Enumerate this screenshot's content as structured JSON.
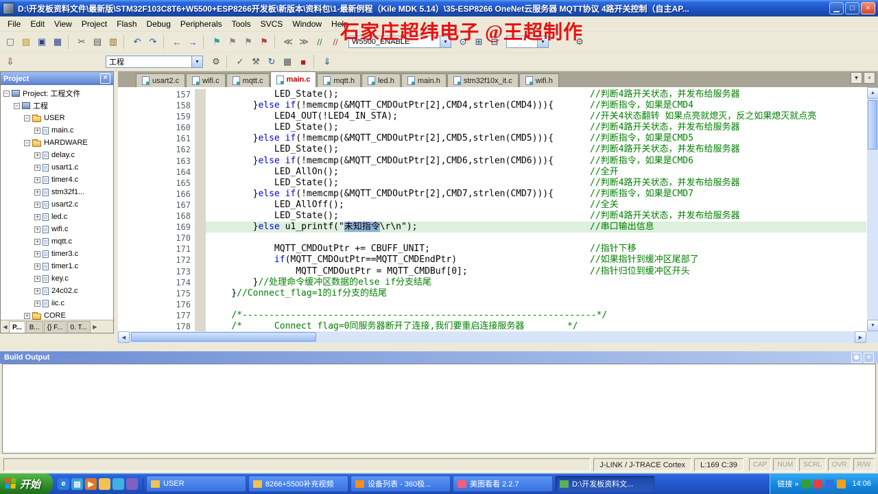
{
  "window": {
    "title": "D:\\开发板资料文件\\最新版\\STM32F103C8T6+W5500+ESP8266开发板\\新版本\\资料包\\1-最新例程（Kile MDK 5.14）\\35-ESP8266 OneNet云服务器 MQTT协议 4路开关控制（自主AP...",
    "overlay_text": "石家庄超纬电子 @王超制作",
    "buttons": {
      "minimize": "▁",
      "maximize": "□",
      "close": "×"
    }
  },
  "icons": {
    "chevron_down": "▼",
    "close": "×",
    "pin": "◉",
    "scroll_left": "◀",
    "scroll_right": "▶",
    "links_chevron": "»",
    "combo_arrow": "▼"
  },
  "menu": {
    "items": [
      "File",
      "Edit",
      "View",
      "Project",
      "Flash",
      "Debug",
      "Peripherals",
      "Tools",
      "SVCS",
      "Window",
      "Help"
    ]
  },
  "toolbar": {
    "find_value": "W5500_ENABLE",
    "icons_left": [
      {
        "name": "new-file-icon",
        "glyph": "▢",
        "color": "#4a6a9a"
      },
      {
        "name": "open-folder-icon",
        "glyph": "▨",
        "color": "#c09020"
      },
      {
        "name": "save-icon",
        "glyph": "▣",
        "color": "#27408b"
      },
      {
        "name": "save-all-icon",
        "glyph": "▦",
        "color": "#27408b"
      },
      {
        "sep": true
      },
      {
        "name": "cut-icon",
        "glyph": "✂",
        "color": "#555555"
      },
      {
        "name": "copy-icon",
        "glyph": "▤",
        "color": "#555555"
      },
      {
        "name": "paste-icon",
        "glyph": "▥",
        "color": "#8a6c1e"
      },
      {
        "sep": true
      },
      {
        "name": "undo-icon",
        "glyph": "↶",
        "color": "#2458b0"
      },
      {
        "name": "redo-icon",
        "glyph": "↷",
        "color": "#2458b0"
      },
      {
        "sep": true
      },
      {
        "name": "back-icon",
        "glyph": "←",
        "color": "#2458b0"
      },
      {
        "name": "forward-icon",
        "glyph": "→",
        "color": "#2458b0"
      },
      {
        "sep": true
      },
      {
        "name": "bookmark-icon",
        "glyph": "⚑",
        "color": "#2aa0a0"
      },
      {
        "name": "prev-bookmark-icon",
        "glyph": "⚑",
        "color": "#888888"
      },
      {
        "name": "next-bookmark-icon",
        "glyph": "⚑",
        "color": "#888888"
      },
      {
        "name": "clear-bookmarks-icon",
        "glyph": "⚑",
        "color": "#b04040"
      },
      {
        "sep": true
      },
      {
        "name": "unindent-icon",
        "glyph": "≪",
        "color": "#555555"
      },
      {
        "name": "indent-icon",
        "glyph": "≫",
        "color": "#555555"
      },
      {
        "name": "comment-icon",
        "glyph": "//",
        "color": "#2a8a2a"
      },
      {
        "name": "uncomment-icon",
        "glyph": "//",
        "color": "#b04040"
      }
    ],
    "icons_find": [
      {
        "name": "find-icon",
        "glyph": "⊙",
        "color": "#27408b"
      },
      {
        "name": "find-in-files-icon",
        "glyph": "⊞",
        "color": "#27408b"
      },
      {
        "name": "grep-icon",
        "glyph": "⊟",
        "color": "#27408b"
      }
    ],
    "icons_end": [
      {
        "name": "configure-icon",
        "glyph": "⚙",
        "color": "#555555"
      }
    ]
  },
  "toolbar2": {
    "target_value": "工程",
    "icons_left": [
      {
        "name": "flash-download-icon",
        "glyph": "⇩",
        "color": "#7a2020"
      }
    ],
    "icons_right": [
      {
        "name": "options-target-icon",
        "glyph": "⚙",
        "color": "#555555"
      },
      {
        "sep": true
      },
      {
        "name": "translate-icon",
        "glyph": "✓",
        "color": "#2a7a2a"
      },
      {
        "name": "build-icon",
        "glyph": "⚒",
        "color": "#555555"
      },
      {
        "name": "rebuild-icon",
        "glyph": "↻",
        "color": "#2458b0"
      },
      {
        "name": "batch-build-icon",
        "glyph": "▦",
        "color": "#555555"
      },
      {
        "name": "stop-build-icon",
        "glyph": "■",
        "color": "#b02020"
      },
      {
        "sep": true
      },
      {
        "name": "download-icon",
        "glyph": "⇓",
        "color": "#27408b"
      }
    ]
  },
  "project_panel": {
    "title": "Project",
    "tree": [
      {
        "label": "Project: 工程文件",
        "level": 0,
        "box": "minus",
        "icon": "chip"
      },
      {
        "label": "工程",
        "level": 1,
        "box": "minus",
        "icon": "chip"
      },
      {
        "label": "USER",
        "level": 2,
        "box": "minus",
        "icon": "folder"
      },
      {
        "label": "main.c",
        "level": 3,
        "box": "plus",
        "icon": "file"
      },
      {
        "label": "HARDWARE",
        "level": 2,
        "box": "minus",
        "icon": "folder"
      },
      {
        "label": "delay.c",
        "level": 3,
        "box": "plus",
        "icon": "file"
      },
      {
        "label": "usart1.c",
        "level": 3,
        "box": "plus",
        "icon": "file"
      },
      {
        "label": "timer4.c",
        "level": 3,
        "box": "plus",
        "icon": "file"
      },
      {
        "label": "stm32f1...",
        "level": 3,
        "box": "plus",
        "icon": "file"
      },
      {
        "label": "usart2.c",
        "level": 3,
        "box": "plus",
        "icon": "file"
      },
      {
        "label": "led.c",
        "level": 3,
        "box": "plus",
        "icon": "file"
      },
      {
        "label": "wifi.c",
        "level": 3,
        "box": "plus",
        "icon": "file"
      },
      {
        "label": "mqtt.c",
        "level": 3,
        "box": "plus",
        "icon": "file"
      },
      {
        "label": "timer3.c",
        "level": 3,
        "box": "plus",
        "icon": "file"
      },
      {
        "label": "timer1.c",
        "level": 3,
        "box": "plus",
        "icon": "file"
      },
      {
        "label": "key.c",
        "level": 3,
        "box": "plus",
        "icon": "file"
      },
      {
        "label": "24c02.c",
        "level": 3,
        "box": "plus",
        "icon": "file"
      },
      {
        "label": "iic.c",
        "level": 3,
        "box": "plus",
        "icon": "file"
      },
      {
        "label": "CORE",
        "level": 2,
        "box": "plus",
        "icon": "folder"
      }
    ],
    "bottom_tabs": [
      {
        "label": "P...",
        "name": "tab-project",
        "active": true
      },
      {
        "label": "B...",
        "name": "tab-books"
      },
      {
        "label": "{} F...",
        "name": "tab-functions"
      },
      {
        "label": "0. T...",
        "name": "tab-templates"
      }
    ]
  },
  "editor": {
    "tabs": [
      {
        "label": "usart2.c"
      },
      {
        "label": "wifi.c"
      },
      {
        "label": "mqtt.c"
      },
      {
        "label": "main.c",
        "active": true
      },
      {
        "label": "mqtt.h"
      },
      {
        "label": "led.h"
      },
      {
        "label": "main.h"
      },
      {
        "label": "stm32f10x_it.c"
      },
      {
        "label": "wifi.h"
      }
    ],
    "keywords": [
      "else",
      "if"
    ],
    "lines": [
      {
        "n": 157,
        "code": "            LED_State();",
        "cmt": "//判断4路开关状态，并发布给服务器",
        "col": true
      },
      {
        "n": 158,
        "code": "        }else if(!memcmp(&MQTT_CMDOutPtr[2],CMD4,strlen(CMD4))){",
        "cmt": "//判断指令，如果是CMD4",
        "col": true
      },
      {
        "n": 159,
        "code": "            LED4_OUT(!LED4_IN_STA);",
        "cmt": "//开关4状态翻转 如果点亮就熄灭，反之如果熄灭就点亮",
        "col": true
      },
      {
        "n": 160,
        "code": "            LED_State();",
        "cmt": "//判断4路开关状态，并发布给服务器",
        "col": true
      },
      {
        "n": 161,
        "code": "        }else if(!memcmp(&MQTT_CMDOutPtr[2],CMD5,strlen(CMD5))){",
        "cmt": "//判断指令，如果是CMD5",
        "col": true
      },
      {
        "n": 162,
        "code": "            LED_State();",
        "cmt": "//判断4路开关状态，并发布给服务器",
        "col": true
      },
      {
        "n": 163,
        "code": "        }else if(!memcmp(&MQTT_CMDOutPtr[2],CMD6,strlen(CMD6))){",
        "cmt": "//判断指令，如果是CMD6",
        "col": true
      },
      {
        "n": 164,
        "code": "            LED_AllOn();",
        "cmt": "//全开",
        "col": true
      },
      {
        "n": 165,
        "code": "            LED_State();",
        "cmt": "//判断4路开关状态，并发布给服务器",
        "col": true
      },
      {
        "n": 166,
        "code": "        }else if(!memcmp(&MQTT_CMDOutPtr[2],CMD7,strlen(CMD7))){",
        "cmt": "//判断指令，如果是CMD7",
        "col": true
      },
      {
        "n": 167,
        "code": "            LED_AllOff();",
        "cmt": "//全关",
        "col": true
      },
      {
        "n": 168,
        "code": "            LED_State();",
        "cmt": "//判断4路开关状态，并发布给服务器",
        "col": true
      },
      {
        "n": 169,
        "code": "        }else u1_printf(\"未知指令\\r\\n\");",
        "cmt": "//串口输出信息",
        "col": true,
        "hl": true,
        "sel": "未知指令"
      },
      {
        "n": 170,
        "code": ""
      },
      {
        "n": 171,
        "code": "            MQTT_CMDOutPtr += CBUFF_UNIT;",
        "cmt": "//指针下移",
        "col": true
      },
      {
        "n": 172,
        "code": "            if(MQTT_CMDOutPtr==MQTT_CMDEndPtr)",
        "cmt": "//如果指针到缓冲区尾部了",
        "col": true
      },
      {
        "n": 173,
        "code": "                MQTT_CMDOutPtr = MQTT_CMDBuf[0];",
        "cmt": "//指针归位到缓冲区开头",
        "col": true
      },
      {
        "n": 174,
        "code": "        }",
        "cmt": "//处理命令缓冲区数据的else if分支结尾",
        "col": false
      },
      {
        "n": 175,
        "code": "    }",
        "cmt": "//Connect_flag=1的if分支的结尾",
        "col": false
      },
      {
        "n": 176,
        "code": ""
      },
      {
        "n": 177,
        "code": "    ",
        "cmt": "/*------------------------------------------------------------------*/",
        "col": false
      },
      {
        "n": 178,
        "code": "    ",
        "cmt": "/*      Connect flag=0同服务器断开了连接,我们要重启连接服务器        */",
        "col": false
      }
    ]
  },
  "build_output": {
    "title": "Build Output"
  },
  "status_bar": {
    "debugger": "J-LINK / J-TRACE Cortex",
    "position": "L:169 C:39",
    "flags": [
      "CAP",
      "NUM",
      "SCRL",
      "OVR",
      "R/W"
    ]
  },
  "taskbar": {
    "start_label": "开始",
    "quick_launch": [
      {
        "name": "quick-launch-browser-icon",
        "color": "#2a7de0",
        "glyph": "e"
      },
      {
        "name": "quick-launch-desktop-icon",
        "color": "#3aa0d8",
        "glyph": "▤"
      },
      {
        "name": "quick-launch-media-icon",
        "color": "#e07820",
        "glyph": "▶"
      },
      {
        "name": "quick-launch-folder-icon",
        "color": "#f2c14e",
        "glyph": ""
      },
      {
        "name": "quick-launch-messenger-icon",
        "color": "#40b0e0",
        "glyph": ""
      },
      {
        "name": "quick-launch-app-icon",
        "color": "#8060c0",
        "glyph": ""
      }
    ],
    "buttons": [
      {
        "label": "USER",
        "icon_color": "#f2c14e"
      },
      {
        "label": "8266+5500补充视频",
        "icon_color": "#f2c14e"
      },
      {
        "label": "设备列表 - 360极...",
        "icon_color": "#ff8c1a"
      },
      {
        "label": "美图看看 2.2.7",
        "icon_color": "#ff5a7a"
      },
      {
        "label": "D:\\开发板资料文...",
        "icon_color": "#58b058",
        "active": true
      }
    ],
    "links_label": "链接",
    "tray_icons": [
      "#30a030",
      "#e04040",
      "#3070e0",
      "#f0a020"
    ],
    "time": "14:06"
  }
}
